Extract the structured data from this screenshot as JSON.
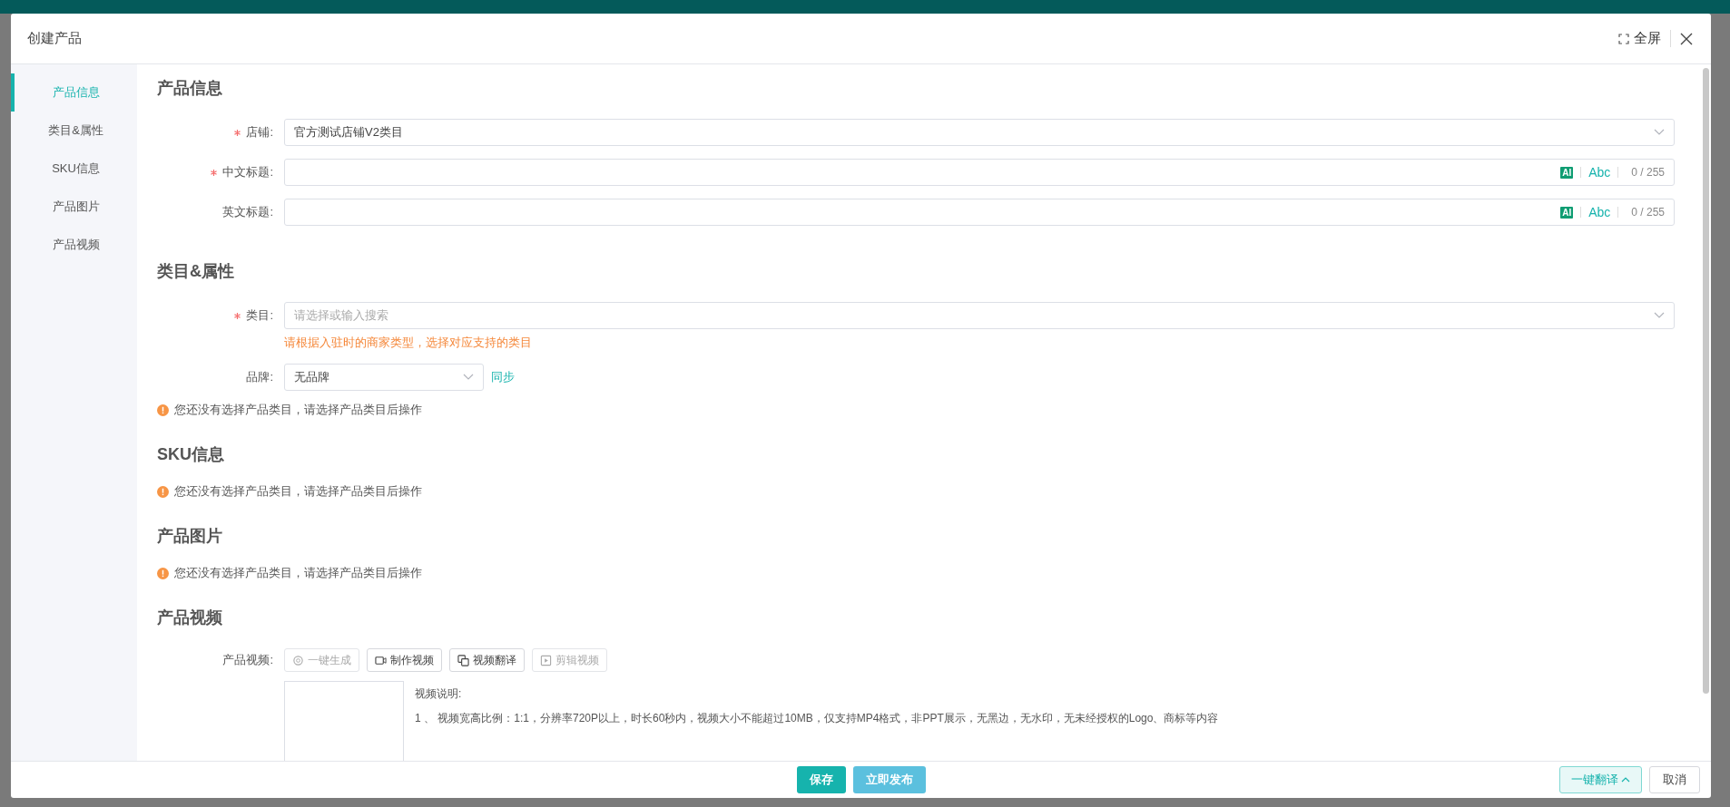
{
  "dialog": {
    "title": "创建产品",
    "fullscreen_label": "全屏"
  },
  "nav": [
    {
      "label": "产品信息",
      "selected": true
    },
    {
      "label": "类目&属性",
      "selected": false
    },
    {
      "label": "SKU信息",
      "selected": false
    },
    {
      "label": "产品图片",
      "selected": false
    },
    {
      "label": "产品视频",
      "selected": false
    }
  ],
  "product_info": {
    "heading": "产品信息",
    "fields": [
      {
        "label": "店铺:",
        "required": true,
        "kind": "select",
        "value": "官方测试店铺V2类目"
      },
      {
        "label": "中文标题:",
        "required": true,
        "kind": "title",
        "ai_label": "AI",
        "abc_label": "Abc",
        "counter": "0 / 255"
      },
      {
        "label": "英文标题:",
        "required": false,
        "kind": "title",
        "ai_label": "AI",
        "abc_label": "Abc",
        "counter": "0 / 255"
      }
    ]
  },
  "category": {
    "heading": "类目&属性",
    "fields": [
      {
        "label": "类目:",
        "required": true,
        "kind": "select",
        "placeholder": "请选择或输入搜索",
        "hint": "请根据入驻时的商家类型，选择对应支持的类目"
      },
      {
        "label": "品牌:",
        "required": false,
        "kind": "brand",
        "value": "无品牌",
        "link": "同步"
      }
    ],
    "notice": "您还没有选择产品类目，请选择产品类目后操作"
  },
  "sku": {
    "heading": "SKU信息",
    "notice": "您还没有选择产品类目，请选择产品类目后操作"
  },
  "images": {
    "heading": "产品图片",
    "notice": "您还没有选择产品类目，请选择产品类目后操作"
  },
  "video": {
    "heading": "产品视频",
    "label": "产品视频:",
    "buttons": [
      {
        "label": "一键生成",
        "disabled": true
      },
      {
        "label": "制作视频",
        "disabled": false
      },
      {
        "label": "视频翻译",
        "disabled": false
      },
      {
        "label": "剪辑视频",
        "disabled": true
      }
    ],
    "notes_title": "视频说明:",
    "notes": [
      "1 、 视频宽高比例：1:1，分辨率720P以上，时长60秒内，视频大小不能超过10MB，仅支持MP4格式，非PPT展示，无黑边，无水印，无未经授权的Logo、商标等内容"
    ]
  },
  "footer": {
    "save": "保存",
    "publish": "立即发布",
    "translate": "一键翻译",
    "cancel": "取消"
  }
}
